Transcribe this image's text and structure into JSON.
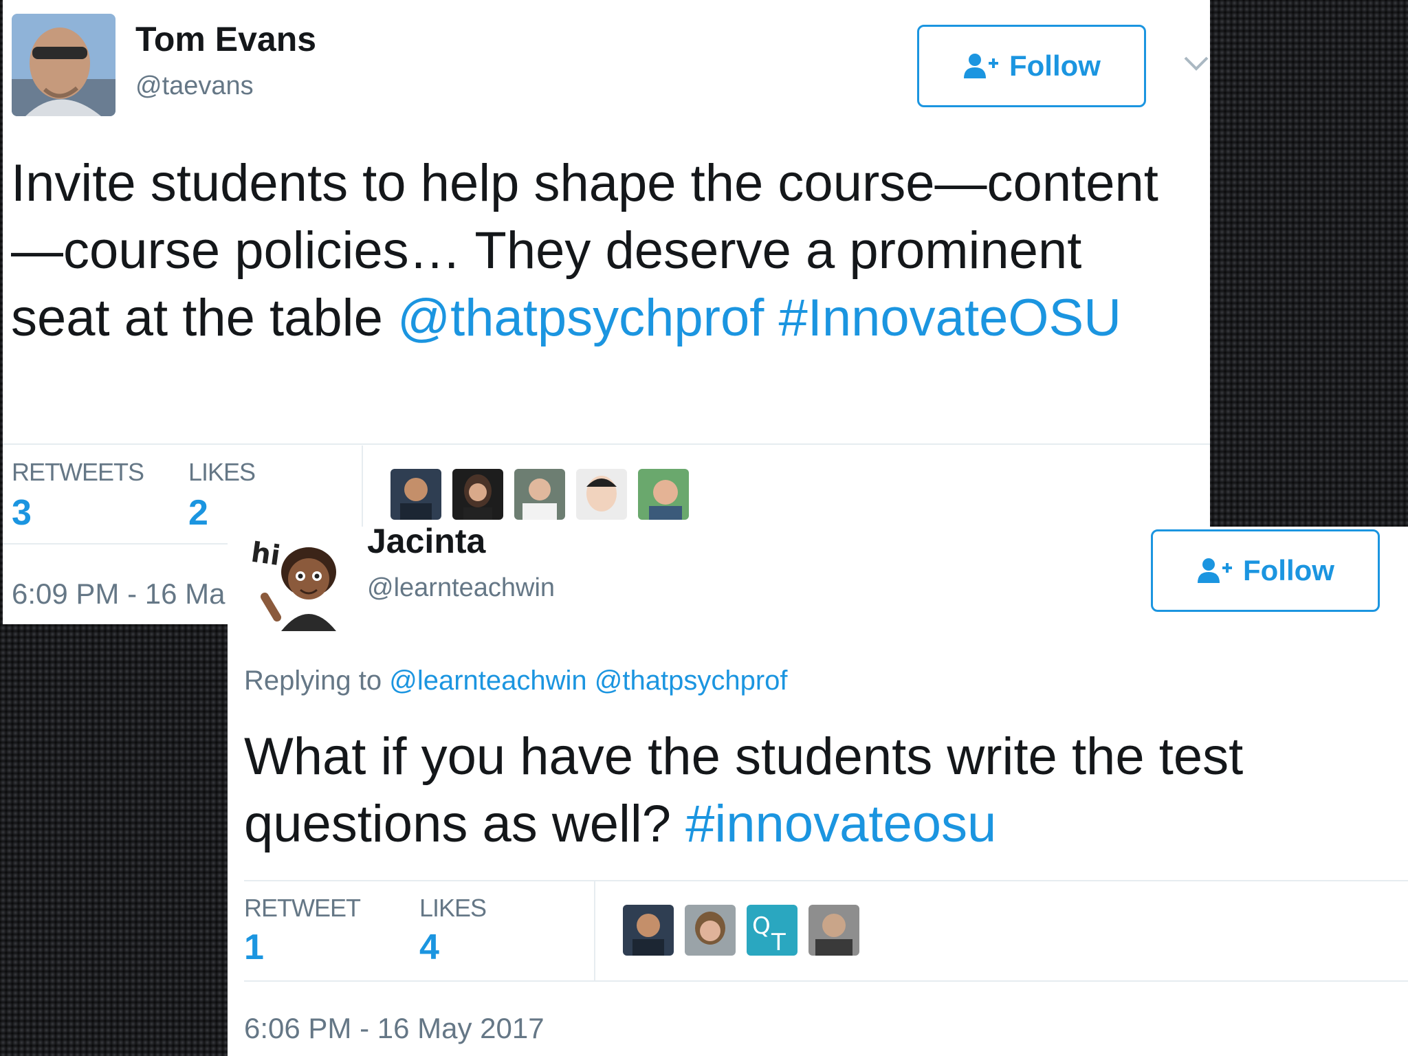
{
  "tweet1": {
    "name": "Tom Evans",
    "handle": "@taevans",
    "follow_label": "Follow",
    "text_main": "Invite students to help shape the course—content—course policies… They deserve a prominent seat at the table ",
    "text_mention": "@thatpsychprof",
    "text_hashtag": "#InnovateOSU",
    "retweets_label": "RETWEETS",
    "retweets_value": "3",
    "likes_label": "LIKES",
    "likes_value": "2",
    "timestamp": "6:09 PM - 16 Ma"
  },
  "tweet2": {
    "name": "Jacinta",
    "handle": "@learnteachwin",
    "avatar_caption": "hi",
    "follow_label": "Follow",
    "replying_label": "Replying to ",
    "replying_mentions": "@learnteachwin @thatpsychprof",
    "text_main": "What if you have the students write the test questions as well? ",
    "text_hashtag": "#innovateosu",
    "retweet_label": "RETWEET",
    "retweet_value": "1",
    "likes_label": "LIKES",
    "likes_value": "4",
    "timestamp": "6:06 PM - 16 May 2017"
  },
  "colors": {
    "link": "#1b95e0",
    "secondary_text": "#657786",
    "divider": "#e6ecf0"
  },
  "icons": [
    "follow-person-plus-icon",
    "chevron-down-icon"
  ]
}
